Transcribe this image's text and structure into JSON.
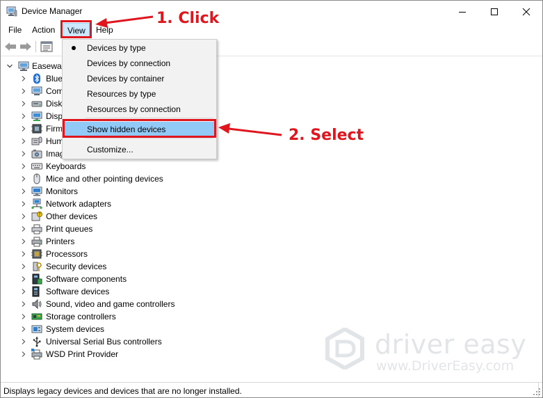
{
  "window": {
    "title": "Device Manager",
    "controls": {
      "minimize": "minimize-icon",
      "maximize": "maximize-icon",
      "close": "close-icon"
    }
  },
  "menubar": {
    "items": [
      {
        "label": "File"
      },
      {
        "label": "Action"
      },
      {
        "label": "View"
      },
      {
        "label": "Help"
      }
    ]
  },
  "toolbar": {
    "icons": [
      "back-arrow-icon",
      "forward-arrow-icon",
      "properties-icon"
    ]
  },
  "tree": {
    "root_label": "Easewar",
    "categories": [
      {
        "label": "Bluetooth",
        "icon": "bluetooth-icon"
      },
      {
        "label": "Computer",
        "icon": "computer-icon"
      },
      {
        "label": "Disk drives",
        "icon": "disk-drive-icon"
      },
      {
        "label": "Display adapters",
        "icon": "display-adapter-icon"
      },
      {
        "label": "Firmware",
        "icon": "firmware-icon"
      },
      {
        "label": "Human Interface Devices",
        "icon": "hid-icon"
      },
      {
        "label": "Imaging devices",
        "icon": "imaging-icon"
      },
      {
        "label": "Keyboards",
        "icon": "keyboard-icon"
      },
      {
        "label": "Mice and other pointing devices",
        "icon": "mouse-icon"
      },
      {
        "label": "Monitors",
        "icon": "monitor-icon"
      },
      {
        "label": "Network adapters",
        "icon": "network-adapter-icon"
      },
      {
        "label": "Other devices",
        "icon": "other-devices-icon"
      },
      {
        "label": "Print queues",
        "icon": "print-queue-icon"
      },
      {
        "label": "Printers",
        "icon": "printer-icon"
      },
      {
        "label": "Processors",
        "icon": "processor-icon"
      },
      {
        "label": "Security devices",
        "icon": "security-device-icon"
      },
      {
        "label": "Software components",
        "icon": "software-component-icon"
      },
      {
        "label": "Software devices",
        "icon": "software-device-icon"
      },
      {
        "label": "Sound, video and game controllers",
        "icon": "sound-icon"
      },
      {
        "label": "Storage controllers",
        "icon": "storage-controller-icon"
      },
      {
        "label": "System devices",
        "icon": "system-device-icon"
      },
      {
        "label": "Universal Serial Bus controllers",
        "icon": "usb-icon"
      },
      {
        "label": "WSD Print Provider",
        "icon": "wsd-printer-icon"
      }
    ]
  },
  "view_menu": {
    "items": [
      {
        "label": "Devices by type",
        "checked": true
      },
      {
        "label": "Devices by connection",
        "checked": false
      },
      {
        "label": "Devices by container",
        "checked": false
      },
      {
        "label": "Resources by type",
        "checked": false
      },
      {
        "label": "Resources by connection",
        "checked": false
      },
      {
        "label": "Show hidden devices",
        "checked": false,
        "highlighted": true
      },
      {
        "label": "Customize...",
        "checked": false
      }
    ]
  },
  "annotations": {
    "step1": "1. Click",
    "step2": "2. Select",
    "color": "#e0161f"
  },
  "watermark": {
    "title": "driver easy",
    "url": "www.DriverEasy.com"
  },
  "statusbar": {
    "text": "Displays legacy devices and devices that are no longer installed."
  }
}
